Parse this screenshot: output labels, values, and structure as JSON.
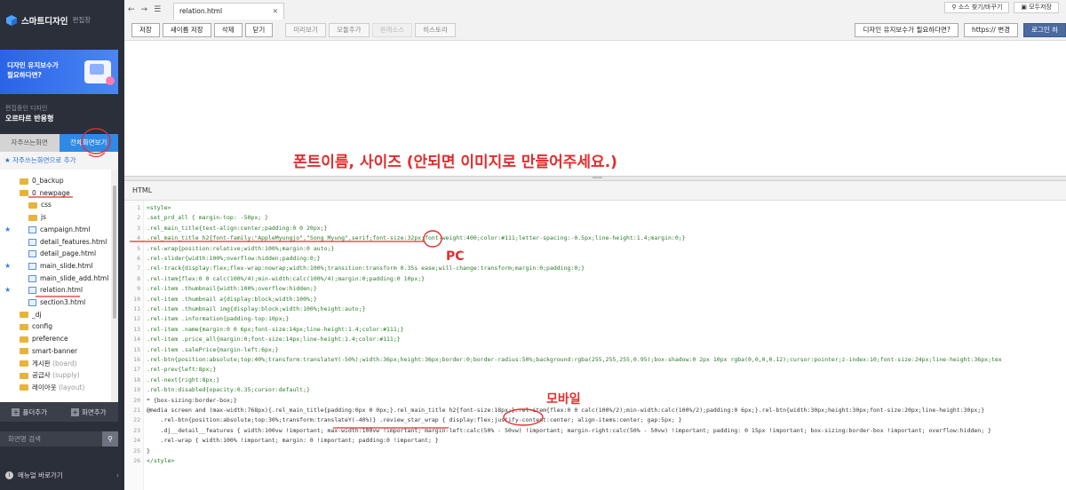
{
  "sidebar": {
    "brand_title": "스마트디자인",
    "brand_sub": "편집창",
    "banner_text_1": "디자인 유지보수가",
    "banner_text_2": "필요하다면?",
    "design_label": "편집중인 디자인",
    "design_name": "오르타르 반응형",
    "tab_favorites": "자주쓰는화면",
    "tab_all": "전체화면보기",
    "add_favorite": "★ 자주쓰는화면으로 추가",
    "tree": [
      {
        "label": "0_backup",
        "type": "folder",
        "star": false
      },
      {
        "label": "0_newpage",
        "type": "folder-open",
        "star": false
      },
      {
        "label": "css",
        "type": "folder",
        "star": false
      },
      {
        "label": "js",
        "type": "folder",
        "star": false
      },
      {
        "label": "campaign.html",
        "type": "file",
        "star": true
      },
      {
        "label": "detail_features.html",
        "type": "file",
        "star": false
      },
      {
        "label": "detail_page.html",
        "type": "file",
        "star": false
      },
      {
        "label": "main_slide.html",
        "type": "file",
        "star": true
      },
      {
        "label": "main_slide_add.html",
        "type": "file",
        "star": false
      },
      {
        "label": "relation.html",
        "type": "file",
        "star": true
      },
      {
        "label": "section3.html",
        "type": "file",
        "star": false
      },
      {
        "label": "_dj",
        "type": "folder",
        "star": false
      },
      {
        "label": "config",
        "type": "folder",
        "star": false
      },
      {
        "label": "preference",
        "type": "folder",
        "star": false
      },
      {
        "label": "smart-banner",
        "type": "folder",
        "star": false
      },
      {
        "label": "게시판",
        "sub": "(board)",
        "type": "folder",
        "star": false
      },
      {
        "label": "공급사",
        "sub": "(supply)",
        "type": "folder",
        "star": false
      },
      {
        "label": "레이아웃",
        "sub": "(layout)",
        "type": "folder",
        "star": false
      }
    ],
    "add_folder": "폴더추가",
    "add_screen": "화면추가",
    "search_placeholder": "화면명 검색",
    "shortcut": "메뉴얼 바로가기"
  },
  "top": {
    "tab_filename": "relation.html",
    "source_compare": "소스 찾기/바꾸기",
    "save_all": "모두저장",
    "buttons": {
      "save": "저장",
      "save_as": "새이름 저장",
      "delete": "삭제",
      "close": "닫기"
    },
    "light_buttons": {
      "preview": "미리보기",
      "collapse": "모듈추가",
      "undo": "원래소스",
      "history": "히스토리"
    },
    "maintenance": "디자인 유지보수가 필요하다면?",
    "https_change": "https:// 변경",
    "login": "로그인 하"
  },
  "preview": {
    "note": "폰트이름, 사이즈 (안되면 이미지로 만들어주세요.)"
  },
  "code_header": "HTML",
  "code": [
    "<style>",
    ".set_prd_all { margin-top: -50px; }",
    ".rel_main_title{text-align:center;padding:0 0 20px;}",
    ".rel_main_title h2{font-family:\"AppleMyungjo\",\"Song Myung\",serif;font-size:32px;font-weight:400;color:#111;letter-spacing:-0.5px;line-height:1.4;margin:0;}",
    ".rel-wrap{position:relative;width:100%;margin:0 auto;}",
    ".rel-slider{width:100%;overflow:hidden;padding:0;}",
    ".rel-track{display:flex;flex-wrap:nowrap;width:100%;transition:transform 0.35s ease;will-change:transform;margin:0;padding:0;}",
    ".rel-item{flex:0 0 calc(100%/4);min-width:calc(100%/4);margin:0;padding:0 10px;}",
    ".rel-item .thumbnail{width:100%;overflow:hidden;}",
    ".rel-item .thumbnail a{display:block;width:100%;}",
    ".rel-item .thumbnail img{display:block;width:100%;height:auto;}",
    ".rel-item .information{padding-top:10px;}",
    ".rel-item .name{margin:0 0 6px;font-size:14px;line-height:1.4;color:#111;}",
    ".rel-item .price_all{margin:0;font-size:14px;line-height:1.4;color:#111;}",
    ".rel-item .salePrice{margin-left:6px;}",
    ".rel-btn{position:absolute;top:40%;transform:translateY(-50%);width:36px;height:36px;border:0;border-radius:50%;background:rgba(255,255,255,0.95);box-shadow:0 2px 10px rgba(0,0,0,0.12);cursor:pointer;z-index:10;font-size:24px;line-height:36px;tex",
    ".rel-prev{left:8px;}",
    ".rel-next{right:8px;}",
    ".rel-btn:disabled{opacity:0.35;cursor:default;}",
    "* {box-sizing:border-box;}",
    "@media screen and (max-width:768px){.rel_main_title{padding:0px 0 0px;}.rel_main_title h2{font-size:18px;}.rel-item{flex:0 0 calc(100%/2);min-width:calc(100%/2);padding:0 6px;}.rel-btn{width:30px;height:30px;font-size:20px;line-height:30px;}",
    "    .rel-btn{position:absolute;top:30%;transform:translateY(-40%)} .review_star_wrap { display:flex;justify-content:center; align-items:center; gap:5px; }",
    "    .dj__detail__features { width:100vw !important; max-width:100vw !important; margin-left:calc(50% - 50vw) !important; margin-right:calc(50% - 50vw) !important; padding: 0 15px !important; box-sizing:border-box !important; overflow:hidden; }",
    "    .rel-wrap { width:100% !important; margin: 0 !important; padding:0 !important; }",
    "}",
    "</style>"
  ],
  "annotations": {
    "pc": "PC",
    "mobile": "모바일"
  }
}
